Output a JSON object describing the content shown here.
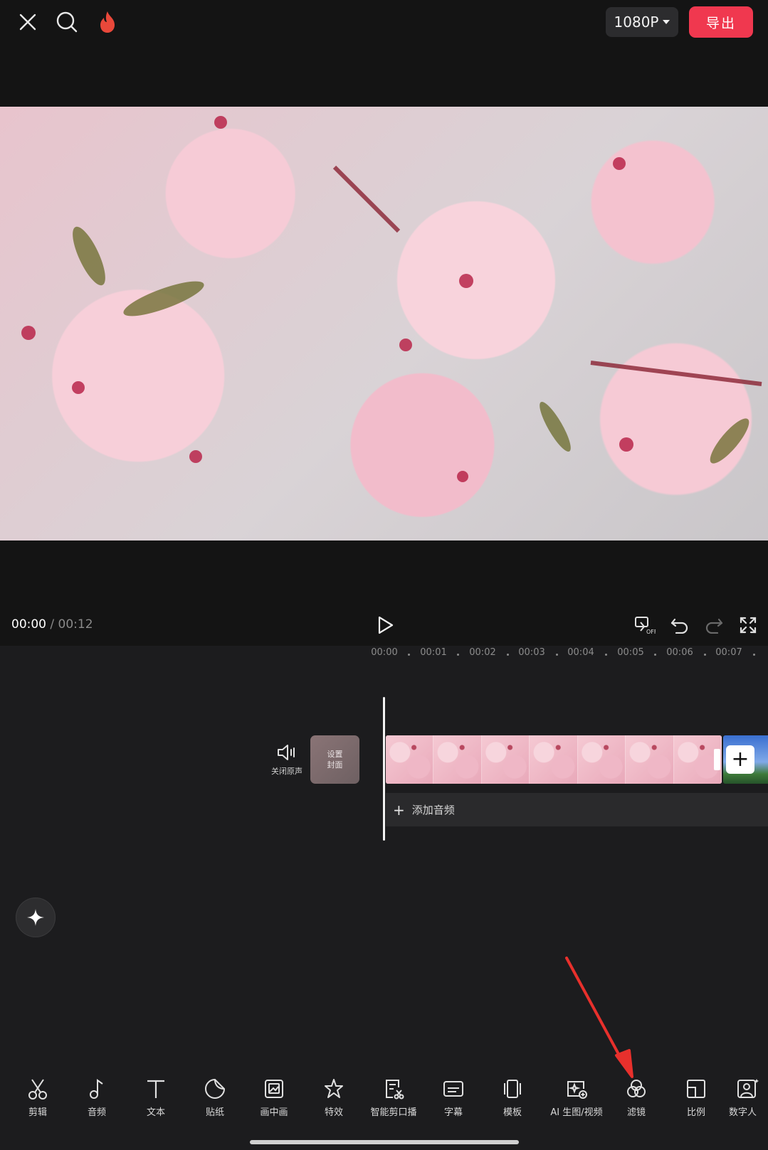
{
  "topbar": {
    "resolution": "1080P",
    "export_label": "导出",
    "icons": [
      "close-icon",
      "search-icon",
      "flame-icon"
    ]
  },
  "player": {
    "current_time": "00:00",
    "separator": "/",
    "total_time": "00:12",
    "icons": [
      "play-icon",
      "keyframe-off-icon",
      "undo-icon",
      "redo-icon",
      "fullscreen-icon"
    ]
  },
  "ruler": {
    "ticks": [
      "00:00",
      "00:01",
      "00:02",
      "00:03",
      "00:04",
      "00:05",
      "00:06",
      "00:07"
    ]
  },
  "timeline": {
    "mute_label": "关闭原声",
    "cover_label_line1": "设置",
    "cover_label_line2": "封面",
    "add_audio_label": "添加音频",
    "add_clip": "+"
  },
  "toolbar": {
    "items": [
      {
        "label": "剪辑",
        "icon": "scissors-icon"
      },
      {
        "label": "音频",
        "icon": "music-note-icon"
      },
      {
        "label": "文本",
        "icon": "text-icon"
      },
      {
        "label": "贴纸",
        "icon": "sticker-icon"
      },
      {
        "label": "画中画",
        "icon": "picture-in-picture-icon"
      },
      {
        "label": "特效",
        "icon": "star-effect-icon"
      },
      {
        "label": "智能剪口播",
        "icon": "smart-cut-icon"
      },
      {
        "label": "字幕",
        "icon": "subtitle-icon"
      },
      {
        "label": "模板",
        "icon": "template-icon"
      },
      {
        "label": "AI 生图/视频",
        "icon": "ai-generate-icon"
      },
      {
        "label": "滤镜",
        "icon": "filter-icon"
      },
      {
        "label": "比例",
        "icon": "ratio-icon"
      },
      {
        "label": "数字人",
        "icon": "digital-human-icon"
      }
    ]
  },
  "colors": {
    "background": "#1c1c1e",
    "topbar": "#141414",
    "export": "#f0384f",
    "annotation_arrow": "#e8302c"
  }
}
